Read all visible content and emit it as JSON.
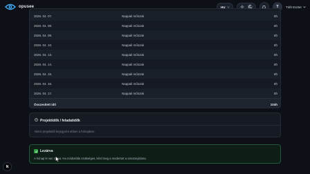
{
  "brand": {
    "name": "opusee"
  },
  "header": {
    "language": "HU",
    "theme_options": [
      "sun-icon",
      "moon-icon"
    ],
    "avatar_initial": "T",
    "user_name": "Tóth Eszter"
  },
  "table": {
    "rows": [
      {
        "date": "2026. 04. 07.",
        "type": "Nappali műszak",
        "hours": "8h"
      },
      {
        "date": "2026. 04. 08.",
        "type": "Nappali műszak",
        "hours": "8h"
      },
      {
        "date": "2026. 04. 09.",
        "type": "Nappali műszak",
        "hours": "8h"
      },
      {
        "date": "2026. 04. 10.",
        "type": "Nappali műszak",
        "hours": "8h"
      },
      {
        "date": "2026. 04. 13.",
        "type": "Nappali műszak",
        "hours": "8h"
      },
      {
        "date": "2026. 04. 14.",
        "type": "Nappali műszak",
        "hours": "8h"
      },
      {
        "date": "2026. 04. 15.",
        "type": "Nappali műszak",
        "hours": "8h"
      },
      {
        "date": "2026. 04. 16.",
        "type": "Nappali műszak",
        "hours": "8h"
      },
      {
        "date": "2026. 04. 17.",
        "type": "Nappali műszak",
        "hours": "8h"
      }
    ],
    "total_label": "Összesített idő",
    "total_value": "104h"
  },
  "projects": {
    "title": "Projektidők / feladatidők",
    "empty_text": "Nincs projektidő bejegyzés ebben a hónapban."
  },
  "closed": {
    "title": "Lezárva",
    "text": "A hónap le van zárva. Ha módosítás szükséges, kérd meg a modertort a visszanyitásra."
  },
  "fab": {
    "label": "N"
  },
  "colors": {
    "accent_green": "#2ea043",
    "background": "#0d1117",
    "card": "#161b23"
  }
}
